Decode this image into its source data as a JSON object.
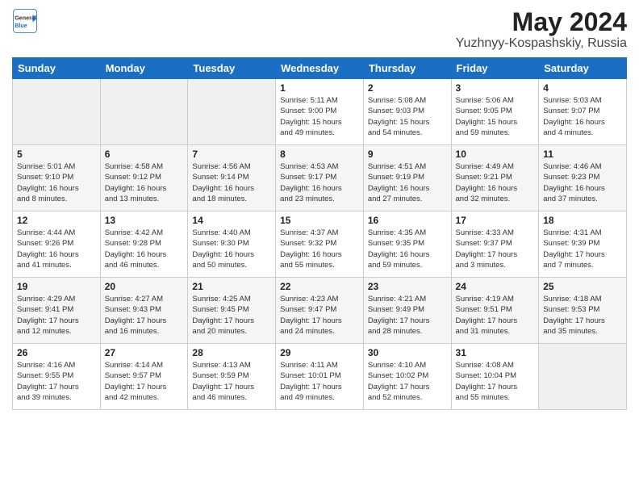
{
  "logo": {
    "general": "General",
    "blue": "Blue"
  },
  "title": "May 2024",
  "location": "Yuzhnyy-Kospashskiy, Russia",
  "headers": [
    "Sunday",
    "Monday",
    "Tuesday",
    "Wednesday",
    "Thursday",
    "Friday",
    "Saturday"
  ],
  "weeks": [
    [
      {
        "day": "",
        "info": ""
      },
      {
        "day": "",
        "info": ""
      },
      {
        "day": "",
        "info": ""
      },
      {
        "day": "1",
        "info": "Sunrise: 5:11 AM\nSunset: 9:00 PM\nDaylight: 15 hours\nand 49 minutes."
      },
      {
        "day": "2",
        "info": "Sunrise: 5:08 AM\nSunset: 9:03 PM\nDaylight: 15 hours\nand 54 minutes."
      },
      {
        "day": "3",
        "info": "Sunrise: 5:06 AM\nSunset: 9:05 PM\nDaylight: 15 hours\nand 59 minutes."
      },
      {
        "day": "4",
        "info": "Sunrise: 5:03 AM\nSunset: 9:07 PM\nDaylight: 16 hours\nand 4 minutes."
      }
    ],
    [
      {
        "day": "5",
        "info": "Sunrise: 5:01 AM\nSunset: 9:10 PM\nDaylight: 16 hours\nand 8 minutes."
      },
      {
        "day": "6",
        "info": "Sunrise: 4:58 AM\nSunset: 9:12 PM\nDaylight: 16 hours\nand 13 minutes."
      },
      {
        "day": "7",
        "info": "Sunrise: 4:56 AM\nSunset: 9:14 PM\nDaylight: 16 hours\nand 18 minutes."
      },
      {
        "day": "8",
        "info": "Sunrise: 4:53 AM\nSunset: 9:17 PM\nDaylight: 16 hours\nand 23 minutes."
      },
      {
        "day": "9",
        "info": "Sunrise: 4:51 AM\nSunset: 9:19 PM\nDaylight: 16 hours\nand 27 minutes."
      },
      {
        "day": "10",
        "info": "Sunrise: 4:49 AM\nSunset: 9:21 PM\nDaylight: 16 hours\nand 32 minutes."
      },
      {
        "day": "11",
        "info": "Sunrise: 4:46 AM\nSunset: 9:23 PM\nDaylight: 16 hours\nand 37 minutes."
      }
    ],
    [
      {
        "day": "12",
        "info": "Sunrise: 4:44 AM\nSunset: 9:26 PM\nDaylight: 16 hours\nand 41 minutes."
      },
      {
        "day": "13",
        "info": "Sunrise: 4:42 AM\nSunset: 9:28 PM\nDaylight: 16 hours\nand 46 minutes."
      },
      {
        "day": "14",
        "info": "Sunrise: 4:40 AM\nSunset: 9:30 PM\nDaylight: 16 hours\nand 50 minutes."
      },
      {
        "day": "15",
        "info": "Sunrise: 4:37 AM\nSunset: 9:32 PM\nDaylight: 16 hours\nand 55 minutes."
      },
      {
        "day": "16",
        "info": "Sunrise: 4:35 AM\nSunset: 9:35 PM\nDaylight: 16 hours\nand 59 minutes."
      },
      {
        "day": "17",
        "info": "Sunrise: 4:33 AM\nSunset: 9:37 PM\nDaylight: 17 hours\nand 3 minutes."
      },
      {
        "day": "18",
        "info": "Sunrise: 4:31 AM\nSunset: 9:39 PM\nDaylight: 17 hours\nand 7 minutes."
      }
    ],
    [
      {
        "day": "19",
        "info": "Sunrise: 4:29 AM\nSunset: 9:41 PM\nDaylight: 17 hours\nand 12 minutes."
      },
      {
        "day": "20",
        "info": "Sunrise: 4:27 AM\nSunset: 9:43 PM\nDaylight: 17 hours\nand 16 minutes."
      },
      {
        "day": "21",
        "info": "Sunrise: 4:25 AM\nSunset: 9:45 PM\nDaylight: 17 hours\nand 20 minutes."
      },
      {
        "day": "22",
        "info": "Sunrise: 4:23 AM\nSunset: 9:47 PM\nDaylight: 17 hours\nand 24 minutes."
      },
      {
        "day": "23",
        "info": "Sunrise: 4:21 AM\nSunset: 9:49 PM\nDaylight: 17 hours\nand 28 minutes."
      },
      {
        "day": "24",
        "info": "Sunrise: 4:19 AM\nSunset: 9:51 PM\nDaylight: 17 hours\nand 31 minutes."
      },
      {
        "day": "25",
        "info": "Sunrise: 4:18 AM\nSunset: 9:53 PM\nDaylight: 17 hours\nand 35 minutes."
      }
    ],
    [
      {
        "day": "26",
        "info": "Sunrise: 4:16 AM\nSunset: 9:55 PM\nDaylight: 17 hours\nand 39 minutes."
      },
      {
        "day": "27",
        "info": "Sunrise: 4:14 AM\nSunset: 9:57 PM\nDaylight: 17 hours\nand 42 minutes."
      },
      {
        "day": "28",
        "info": "Sunrise: 4:13 AM\nSunset: 9:59 PM\nDaylight: 17 hours\nand 46 minutes."
      },
      {
        "day": "29",
        "info": "Sunrise: 4:11 AM\nSunset: 10:01 PM\nDaylight: 17 hours\nand 49 minutes."
      },
      {
        "day": "30",
        "info": "Sunrise: 4:10 AM\nSunset: 10:02 PM\nDaylight: 17 hours\nand 52 minutes."
      },
      {
        "day": "31",
        "info": "Sunrise: 4:08 AM\nSunset: 10:04 PM\nDaylight: 17 hours\nand 55 minutes."
      },
      {
        "day": "",
        "info": ""
      }
    ]
  ]
}
